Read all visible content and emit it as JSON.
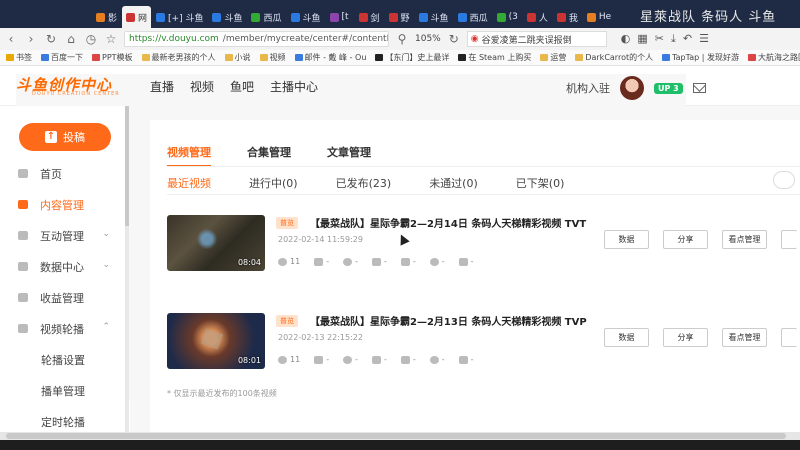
{
  "browser": {
    "tabs": [
      "影",
      "网",
      "[+] 斗鱼",
      "斗鱼",
      "西瓜",
      "斗鱼",
      "[t",
      "剑",
      "野",
      "斗鱼",
      "西瓜",
      "(3",
      "人",
      "我",
      "He"
    ],
    "active_tab_index": 1,
    "overlay_title": "星萊战队 条码人 斗鱼",
    "url_host": "https://v.douyu.com",
    "url_path": "/member/mycreate/center#/contentMa",
    "zoom": "105%",
    "search_text": "谷爱凌第二跳夹误报倒"
  },
  "bookmarks": [
    "书签",
    "百度一下",
    "PPT模板",
    "最新老男孩的个人",
    "小说",
    "视频",
    "邮件 - 戴 峰 - Ou",
    "【东门】史上最详",
    "在 Steam 上购买",
    "运营",
    "DarkCarrot的个人",
    "TapTap | 发现好游",
    "大航海之路国服"
  ],
  "header": {
    "logo_text": "斗鱼创作中心",
    "logo_sub": "DOUYU CREATION CENTER",
    "nav": [
      "直播",
      "视频",
      "鱼吧",
      "主播中心"
    ],
    "join_label": "机构入驻",
    "level_badge": "UP 3"
  },
  "sidebar": {
    "upload_label": "投稿",
    "items": [
      {
        "label": "首页",
        "chev": ""
      },
      {
        "label": "内容管理",
        "chev": ""
      },
      {
        "label": "互动管理",
        "chev": "⌄"
      },
      {
        "label": "数据中心",
        "chev": "⌄"
      },
      {
        "label": "收益管理",
        "chev": ""
      },
      {
        "label": "视频轮播",
        "chev": "⌃"
      },
      {
        "label": "轮播设置",
        "chev": ""
      },
      {
        "label": "播单管理",
        "chev": ""
      },
      {
        "label": "定时轮播",
        "chev": ""
      }
    ],
    "active_index": 1
  },
  "content": {
    "tabs": [
      "视频管理",
      "合集管理",
      "文章管理"
    ],
    "active_tab": 0,
    "filters": [
      "最近视频",
      "进行中(0)",
      "已发布(23)",
      "未通过(0)",
      "已下架(0)"
    ],
    "active_filter": 0,
    "videos": [
      {
        "badge": "普览",
        "title": "【最菜战队】星际争霸2—2月14日 条码人天梯精彩视频 TVT",
        "date": "2022-02-14 11:59:29",
        "duration": "08:04",
        "views": "11",
        "stat_placeholder": "-"
      },
      {
        "badge": "普览",
        "title": "【最菜战队】星际争霸2—2月13日 条码人天梯精彩视频 TVP",
        "date": "2022-02-13 22:15:22",
        "duration": "08:01",
        "views": "11",
        "stat_placeholder": "-"
      }
    ],
    "actions": [
      "数据",
      "分享",
      "看点管理"
    ],
    "note": "* 仅显示最近发布的100条视频"
  },
  "colors": {
    "accent": "#ff6a1a",
    "level_badge": "#1fbf6a",
    "browser_chrome": "#1f2a44"
  }
}
